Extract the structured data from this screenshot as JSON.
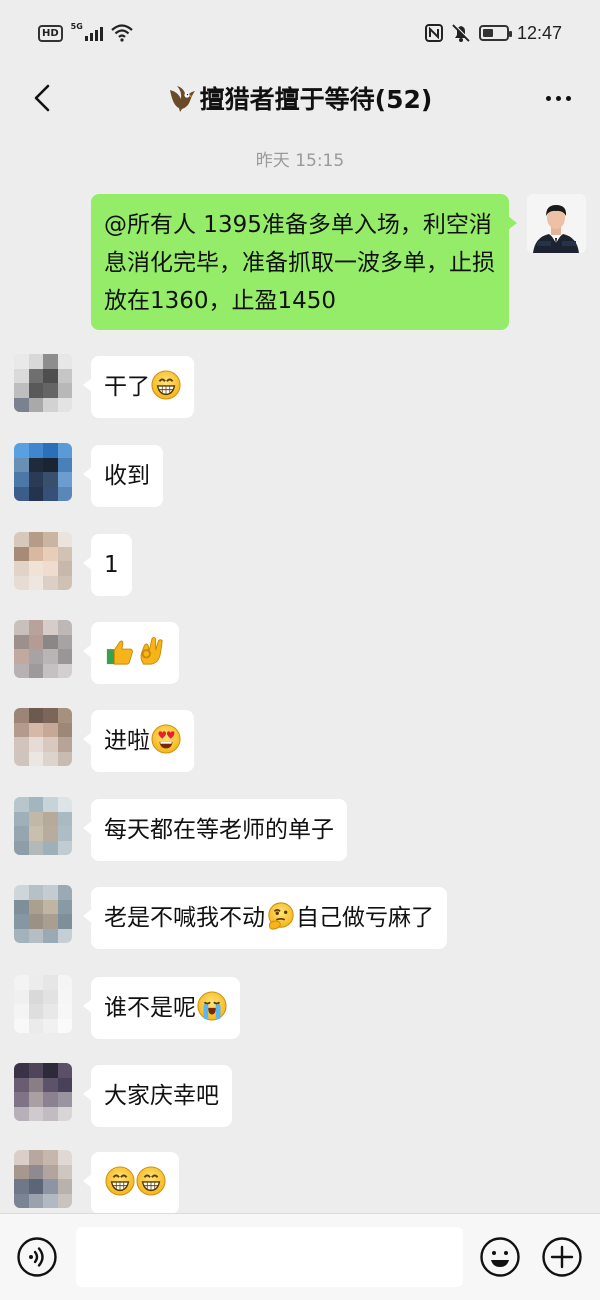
{
  "status_bar": {
    "hd_badge": "HD",
    "network": "5G",
    "time": "12:47",
    "icons": [
      "hd-icon",
      "signal-icon",
      "wifi-icon",
      "nfc-icon",
      "bell-muted-icon",
      "battery-icon"
    ],
    "battery_level": 0.45
  },
  "header": {
    "title": "擅猎者擅于等待(52)",
    "title_icon": "eagle-icon",
    "back_icon": "chevron-left-icon",
    "more_icon": "more-dots-icon"
  },
  "timestamp": "昨天 15:15",
  "messages": [
    {
      "text": "@所有人 1395准备多单入场，利空消息消化完毕，准备抓取一波多单，止损放在1360，止盈1450",
      "sender": "self"
    },
    {
      "text": "干了",
      "emojis": [
        "grin-emoji"
      ]
    },
    {
      "text": "收到",
      "emojis": []
    },
    {
      "text": "1",
      "emojis": []
    },
    {
      "text": "",
      "emojis": [
        "thumbs-up-emoji",
        "ok-hand-emoji"
      ]
    },
    {
      "text": "进啦",
      "emojis": [
        "heart-eyes-emoji"
      ]
    },
    {
      "text": "每天都在等老师的单子",
      "emojis": []
    },
    {
      "text": "老是不喊我不动",
      "emoji_mid": "thinking-emoji",
      "text_after": "自己做亏麻了"
    },
    {
      "text": "谁不是呢",
      "emojis": [
        "crying-emoji"
      ]
    },
    {
      "text": "大家庆幸吧",
      "emojis": []
    },
    {
      "text": "",
      "emojis": [
        "grin-emoji",
        "grin-emoji"
      ]
    }
  ],
  "input_bar": {
    "voice_icon": "voice-icon",
    "emoji_icon": "emoji-face-icon",
    "plus_icon": "plus-circle-icon",
    "input_value": ""
  },
  "colors": {
    "background": "#ededed",
    "my_bubble": "#95ec69",
    "other_bubble": "#ffffff",
    "timestamp": "#9a9a9a"
  }
}
